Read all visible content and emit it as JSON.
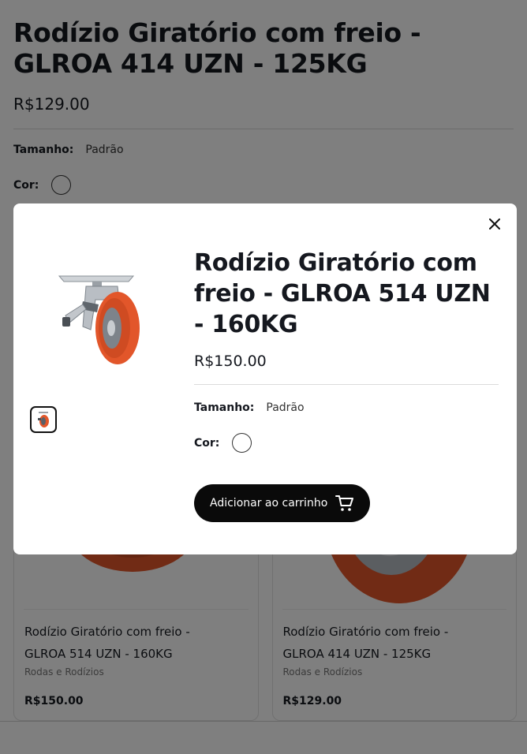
{
  "background": {
    "title": "Rodízio Giratório com freio - GLROA 414 UZN - 125KG",
    "price": "R$129.00",
    "size_label": "Tamanho:",
    "size_value": "Padrão",
    "color_label": "Cor:"
  },
  "cards": [
    {
      "name": "Rodízio Giratório com freio - GLROA 514 UZN - 160KG",
      "category": "Rodas e Rodízios",
      "price": "R$150.00"
    },
    {
      "name": "Rodízio Giratório com freio - GLROA 414 UZN - 125KG",
      "category": "Rodas e Rodízios",
      "price": "R$129.00"
    }
  ],
  "modal": {
    "title": "Rodízio Giratório com freio - GLROA 514 UZN - 160KG",
    "price": "R$150.00",
    "size_label": "Tamanho:",
    "size_value": "Padrão",
    "color_label": "Cor:",
    "add_to_cart_label": "Adicionar ao carrinho"
  },
  "icons": {
    "close": "close-icon",
    "cart": "cart-icon"
  },
  "colors": {
    "wheel_orange": "#e2562a",
    "button_black": "#0a0a0a",
    "overlay": "rgba(0,0,0,0.5)"
  }
}
